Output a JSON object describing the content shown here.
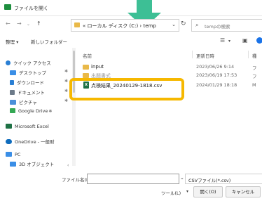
{
  "window": {
    "title": "ファイルを開く"
  },
  "nav": {
    "back": "←",
    "forward": "→",
    "up": "↑",
    "address_prefix": "«",
    "address_path": "ローカル ディスク (C:)  ›  temp",
    "refresh": "↻",
    "search_placeholder": "tempの検索"
  },
  "toolbar": {
    "organize": "整理 ▾",
    "new_folder": "新しいフォルダー",
    "view_icon": "list-view-icon",
    "pane_icon": "pane-icon"
  },
  "sidebar": {
    "items": [
      {
        "label": "クイック アクセス",
        "icon": "star-icon",
        "color": "#2a7fd4"
      },
      {
        "label": "デスクトップ",
        "icon": "desktop-icon",
        "color": "#3a8ee6"
      },
      {
        "label": "ダウンロード",
        "icon": "download-icon",
        "color": "#2a7fd4"
      },
      {
        "label": "ドキュメント",
        "icon": "document-icon",
        "color": "#6c7a89"
      },
      {
        "label": "ピクチャ",
        "icon": "picture-icon",
        "color": "#4a90d9"
      },
      {
        "label": "Google Drive",
        "icon": "google-drive-icon",
        "color": "#34a853"
      },
      {
        "label": "Microsoft Excel",
        "icon": "excel-icon",
        "color": "#1e7145"
      },
      {
        "label": "OneDrive - 一般財",
        "icon": "onedrive-icon",
        "color": "#0f6cbd"
      },
      {
        "label": "PC",
        "icon": "pc-icon",
        "color": "#3a8ee6"
      },
      {
        "label": "3D オブジェクト",
        "icon": "3d-objects-icon",
        "color": "#3a8ee6"
      }
    ],
    "pin": "✱"
  },
  "list": {
    "columns": {
      "name": "名前",
      "modified": "更新日時",
      "type": "種"
    },
    "rows": [
      {
        "name": "input",
        "date": "2023/06/26 9:14",
        "type": "フ",
        "kind": "folder"
      },
      {
        "name": "出題書式",
        "date": "2023/06/19 17:53",
        "type": "フ",
        "kind": "folder"
      },
      {
        "name": "点検結果_20240129-1818.csv",
        "date": "2024/01/29 18:18",
        "type": "M",
        "kind": "csv"
      }
    ]
  },
  "footer": {
    "filename_label": "ファイル名(N):",
    "filename_value": "",
    "filetype": "CSVファイル(*.csv)",
    "tools": "ツール(L)",
    "open": "開く(O)",
    "cancel": "キャンセル"
  },
  "colors": {
    "highlight": "#f6b800",
    "arrow": "#3dbf95"
  }
}
